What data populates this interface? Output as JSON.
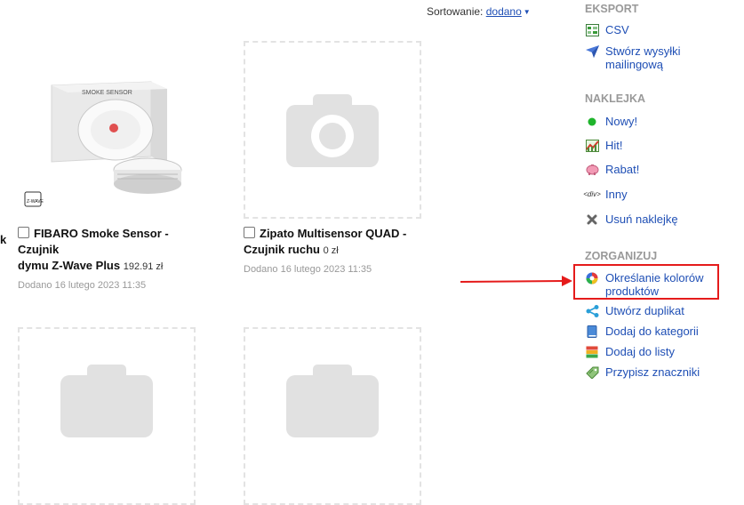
{
  "sort": {
    "label": "Sortowanie:",
    "value": "dodano"
  },
  "products": [
    {
      "title_line1": "FIBARO Smoke Sensor - Czujnik",
      "title_line2": "dymu Z-Wave Plus",
      "price": "192.91 zł",
      "added": "Dodano 16 lutego 2023 11:35",
      "image_icon": "smoke-sensor-photo",
      "box_text": "SMOKE SENSOR",
      "badge_text": "Z-WAVE"
    },
    {
      "title_line1": "Zipato Multisensor QUAD -",
      "title_line2": "Czujnik ruchu",
      "price": "0 zł",
      "added": "Dodano 16 lutego 2023 11:35",
      "image_icon": "camera-placeholder-icon"
    }
  ],
  "left_edge_text": "k",
  "sidebar": {
    "export": {
      "heading": "EKSPORT",
      "items": [
        {
          "label": "CSV",
          "icon": "csv-icon"
        },
        {
          "label_line1": "Stwórz wysyłki",
          "label_line2": "mailingową",
          "icon": "paper-plane-icon"
        }
      ]
    },
    "sticker": {
      "heading": "NAKLEJKA",
      "items": [
        {
          "label": "Nowy!",
          "icon": "green-dot-icon"
        },
        {
          "label": "Hit!",
          "icon": "chart-up-icon"
        },
        {
          "label": "Rabat!",
          "icon": "piggy-bank-icon"
        },
        {
          "label": "Inny",
          "icon": "div-tag-icon",
          "icon_text": "div"
        },
        {
          "label": "Usuń naklejkę",
          "icon": "x-icon"
        }
      ]
    },
    "organize": {
      "heading": "ZORGANIZUJ",
      "items": [
        {
          "label_line1": "Określanie kolorów",
          "label_line2": "produktów",
          "icon": "color-wheel-icon"
        },
        {
          "label": "Utwórz duplikat",
          "icon": "share-icon"
        },
        {
          "label": "Dodaj do kategorii",
          "icon": "book-icon"
        },
        {
          "label": "Dodaj do listy",
          "icon": "stack-icon"
        },
        {
          "label": "Przypisz znaczniki",
          "icon": "tags-icon"
        }
      ]
    }
  },
  "colors": {
    "link": "#1f4fb5",
    "heading": "#999999",
    "highlight": "#e51b1b",
    "muted": "#999999"
  }
}
